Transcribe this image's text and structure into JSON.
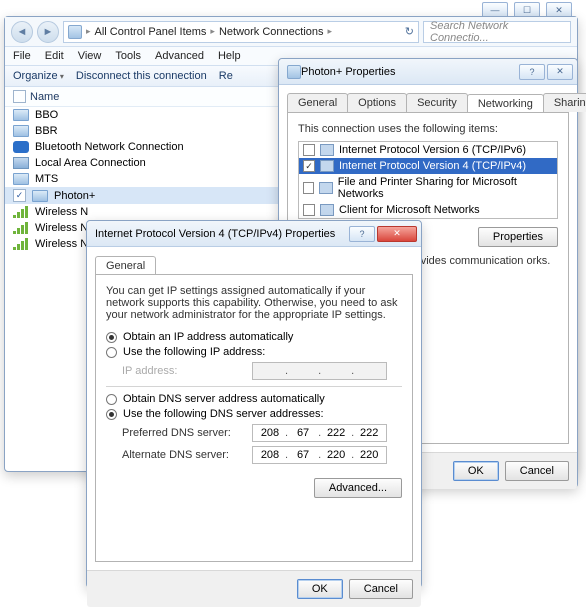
{
  "explorer": {
    "breadcrumb1": "All Control Panel Items",
    "breadcrumb2": "Network Connections",
    "searchPlaceholder": "Search Network Connectio...",
    "menu": {
      "file": "File",
      "edit": "Edit",
      "view": "View",
      "tools": "Tools",
      "advanced": "Advanced",
      "help": "Help"
    },
    "toolbar": {
      "organize": "Organize",
      "disconnect": "Disconnect this connection",
      "re": "Re"
    },
    "header": "Name",
    "rows": [
      {
        "name": "BBO"
      },
      {
        "name": "BBR"
      },
      {
        "name": "Bluetooth Network Connection"
      },
      {
        "name": "Local Area Connection"
      },
      {
        "name": "MTS"
      },
      {
        "name": "Photon+",
        "checked": true
      },
      {
        "name": "Wireless N"
      },
      {
        "name": "Wireless N"
      },
      {
        "name": "Wireless N"
      }
    ]
  },
  "props": {
    "title": "Photon+ Properties",
    "tabs": {
      "general": "General",
      "options": "Options",
      "security": "Security",
      "networking": "Networking",
      "sharing": "Sharing"
    },
    "lead": "This connection uses the following items:",
    "items": [
      {
        "label": "Internet Protocol Version 6 (TCP/IPv6)",
        "checked": false
      },
      {
        "label": "Internet Protocol Version 4 (TCP/IPv4)",
        "checked": true,
        "selected": true
      },
      {
        "label": "File and Printer Sharing for Microsoft Networks",
        "checked": false
      },
      {
        "label": "Client for Microsoft Networks",
        "checked": false
      }
    ],
    "propertiesBtn": "Properties",
    "desc": "net Protocol. The default vides communication orks.",
    "ok": "OK",
    "cancel": "Cancel"
  },
  "ipv4": {
    "title": "Internet Protocol Version 4 (TCP/IPv4) Properties",
    "tab": "General",
    "intro": "You can get IP settings assigned automatically if your network supports this capability. Otherwise, you need to ask your network administrator for the appropriate IP settings.",
    "r1": "Obtain an IP address automatically",
    "r2": "Use the following IP address:",
    "ipLabel": "IP address:",
    "r3": "Obtain DNS server address automatically",
    "r4": "Use the following DNS server addresses:",
    "preferred": "Preferred DNS server:",
    "alternate": "Alternate DNS server:",
    "pref": [
      "208",
      "67",
      "222",
      "222"
    ],
    "alt": [
      "208",
      "67",
      "220",
      "220"
    ],
    "advanced": "Advanced...",
    "ok": "OK",
    "cancel": "Cancel"
  }
}
